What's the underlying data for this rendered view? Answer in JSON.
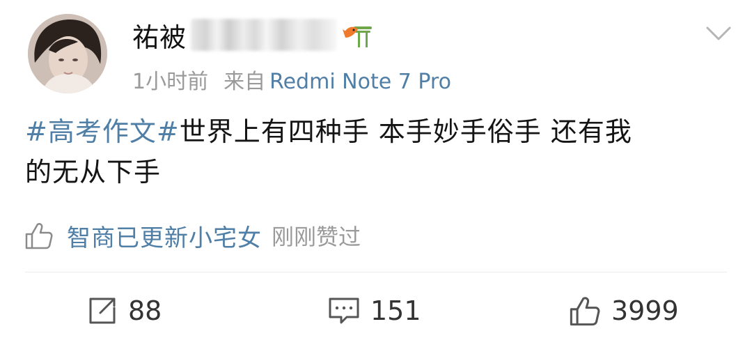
{
  "post": {
    "author": {
      "name_visible": "祐被",
      "name_obscured": true
    },
    "meta": {
      "time": "1小时前",
      "source_label": "来自",
      "source_device": "Redmi Note 7 Pro"
    },
    "content": {
      "hashtag": "#高考作文#",
      "text_line1": "世界上有四种手 本手妙手俗手 还有我",
      "text_line2": "的无从下手"
    },
    "like_note": {
      "user": "智商已更新小宅女",
      "suffix": "刚刚赞过"
    },
    "actions": {
      "repost_count": "88",
      "comment_count": "151",
      "like_count": "3999"
    }
  },
  "colors": {
    "link_blue": "#4f7ea6",
    "meta_gray": "#9a9a9a",
    "text_black": "#141414"
  },
  "icons": {
    "badge": "fish-torii-badge-icon",
    "menu": "chevron-down-icon",
    "like_small": "thumbs-up-icon",
    "repost": "repost-icon",
    "comment": "comment-icon",
    "like": "thumbs-up-icon"
  }
}
